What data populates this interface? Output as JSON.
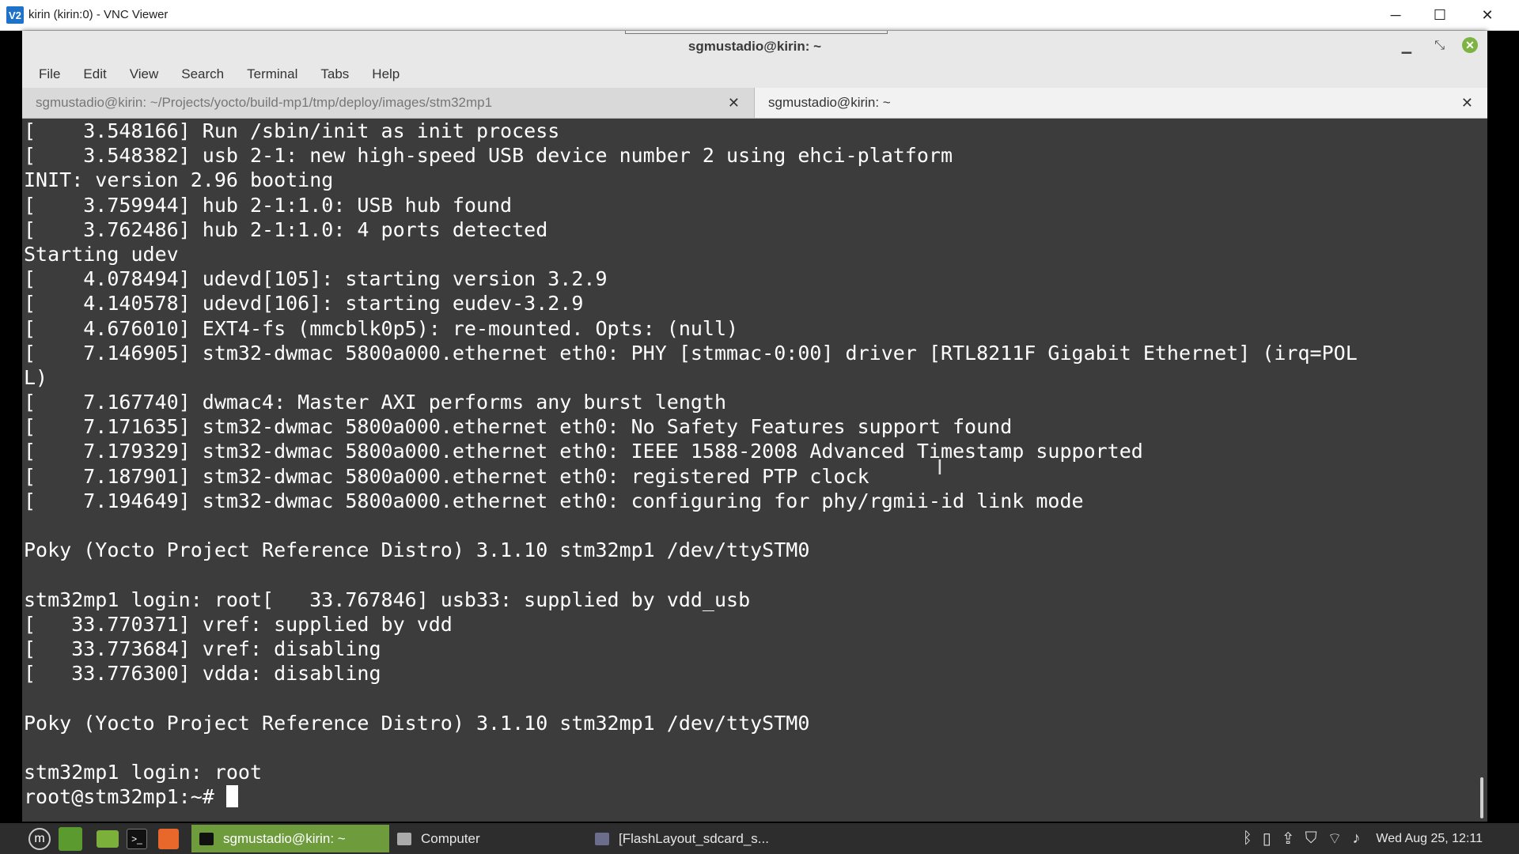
{
  "vnc": {
    "title": "kirin (kirin:0) - VNC Viewer",
    "icon": "V2",
    "minimize": "─",
    "maximize": "☐",
    "close": "✕"
  },
  "terminal": {
    "title": "sgmustadio@kirin: ~",
    "menu": [
      "File",
      "Edit",
      "View",
      "Search",
      "Terminal",
      "Tabs",
      "Help"
    ],
    "tabs": [
      {
        "label": "sgmustadio@kirin: ~/Projects/yocto/build-mp1/tmp/deploy/images/stm32mp1",
        "active": false
      },
      {
        "label": "sgmustadio@kirin: ~",
        "active": true
      }
    ],
    "lines": [
      "[    3.548166] Run /sbin/init as init process",
      "[    3.548382] usb 2-1: new high-speed USB device number 2 using ehci-platform",
      "INIT: version 2.96 booting",
      "[    3.759944] hub 2-1:1.0: USB hub found",
      "[    3.762486] hub 2-1:1.0: 4 ports detected",
      "Starting udev",
      "[    4.078494] udevd[105]: starting version 3.2.9",
      "[    4.140578] udevd[106]: starting eudev-3.2.9",
      "[    4.676010] EXT4-fs (mmcblk0p5): re-mounted. Opts: (null)",
      "[    7.146905] stm32-dwmac 5800a000.ethernet eth0: PHY [stmmac-0:00] driver [RTL8211F Gigabit Ethernet] (irq=POL",
      "L)",
      "[    7.167740] dwmac4: Master AXI performs any burst length",
      "[    7.171635] stm32-dwmac 5800a000.ethernet eth0: No Safety Features support found",
      "[    7.179329] stm32-dwmac 5800a000.ethernet eth0: IEEE 1588-2008 Advanced Timestamp supported",
      "[    7.187901] stm32-dwmac 5800a000.ethernet eth0: registered PTP clock",
      "[    7.194649] stm32-dwmac 5800a000.ethernet eth0: configuring for phy/rgmii-id link mode",
      "",
      "Poky (Yocto Project Reference Distro) 3.1.10 stm32mp1 /dev/ttySTM0",
      "",
      "stm32mp1 login: root[   33.767846] usb33: supplied by vdd_usb",
      "[   33.770371] vref: supplied by vdd",
      "[   33.773684] vref: disabling",
      "[   33.776300] vdda: disabling",
      "",
      "Poky (Yocto Project Reference Distro) 3.1.10 stm32mp1 /dev/ttySTM0",
      "",
      "stm32mp1 login: root"
    ],
    "prompt": "root@stm32mp1:~# "
  },
  "panel": {
    "tasks": [
      {
        "label": "sgmustadio@kirin: ~",
        "active": true
      },
      {
        "label": "Computer",
        "active": false
      },
      {
        "label": "[FlashLayout_sdcard_s...",
        "active": false
      }
    ],
    "clock": "Wed Aug 25, 12:11"
  },
  "colors": {
    "terminal_bg": "#3c3c3c",
    "active_task": "#6e9b3c",
    "panel_bg": "#2d2d2d"
  }
}
